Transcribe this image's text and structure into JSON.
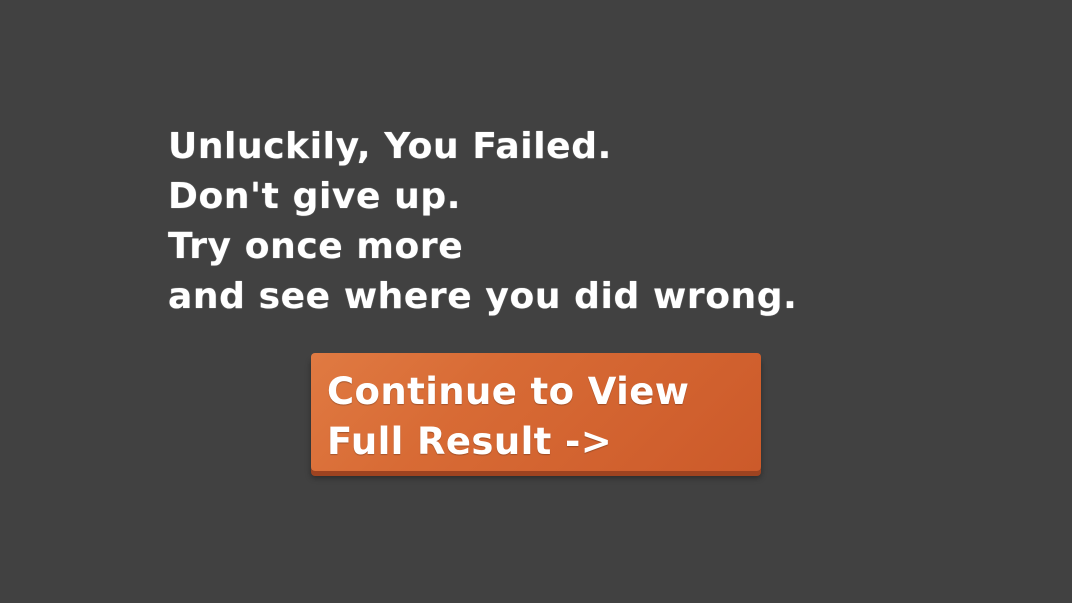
{
  "message": {
    "lines": [
      "Unluckily, You Failed.",
      "Don't give up.",
      "Try once more",
      "and see where you did wrong."
    ]
  },
  "continue_button": {
    "lines": [
      "Continue to View",
      "Full Result ->"
    ]
  },
  "colors": {
    "background": "#414141",
    "text": "#ffffff",
    "button": "#d86b35",
    "button_shadow": "#9e4320"
  }
}
